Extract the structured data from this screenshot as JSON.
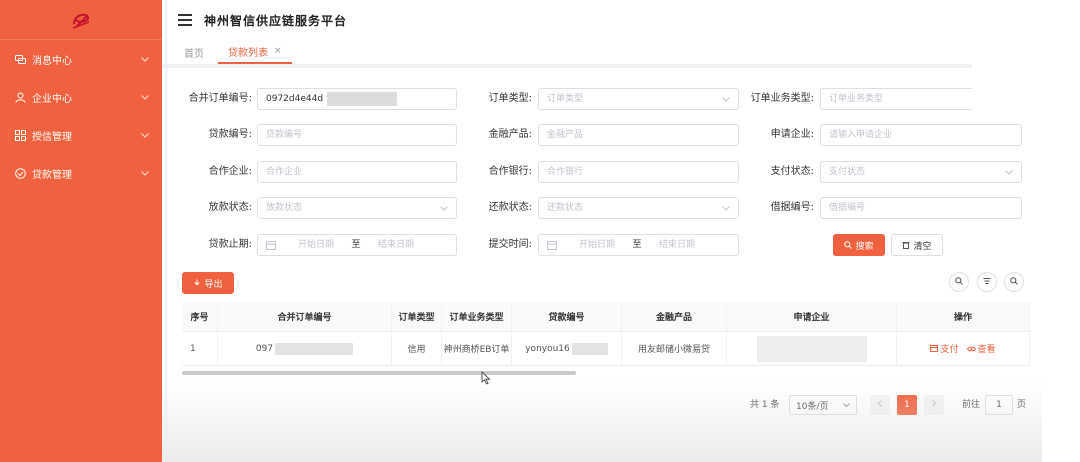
{
  "app": {
    "title": "神州智信供应链服务平台"
  },
  "sidebar": {
    "items": [
      {
        "label": "消息中心",
        "icon": "chat-icon"
      },
      {
        "label": "企业中心",
        "icon": "user-icon"
      },
      {
        "label": "授信管理",
        "icon": "grid-icon"
      },
      {
        "label": "贷款管理",
        "icon": "check-circle-icon"
      }
    ]
  },
  "tabs": {
    "home": "首页",
    "active": "贷款列表",
    "close": "×"
  },
  "filters": {
    "merge_order_no": {
      "label": "合并订单编号:",
      "value": "0972d4e44d"
    },
    "order_type": {
      "label": "订单类型:",
      "placeholder": "订单类型"
    },
    "order_biz_type": {
      "label": "订单业务类型:",
      "placeholder": "订单业务类型"
    },
    "loan_no": {
      "label": "贷款编号:",
      "placeholder": "贷款编号"
    },
    "finance_product": {
      "label": "金融产品:",
      "placeholder": "金融产品"
    },
    "apply_company": {
      "label": "申请企业:",
      "placeholder": "请输入申请企业"
    },
    "partner_company": {
      "label": "合作企业:",
      "placeholder": "合作企业"
    },
    "partner_bank": {
      "label": "合作银行:",
      "placeholder": "合作银行"
    },
    "pay_status": {
      "label": "支付状态:",
      "placeholder": "支付状态"
    },
    "disburse_status": {
      "label": "放款状态:",
      "placeholder": "放款状态"
    },
    "repay_status": {
      "label": "还款状态:",
      "placeholder": "还款状态"
    },
    "receipt_no": {
      "label": "借据编号:",
      "placeholder": "借据编号"
    },
    "loan_expiry": {
      "label": "贷款止期:",
      "start": "开始日期",
      "sep": "至",
      "end": "结束日期"
    },
    "submit_time": {
      "label": "提交时间:",
      "start": "开始日期",
      "sep": "至",
      "end": "结束日期"
    },
    "search_button": "搜索",
    "clear_button": "清空"
  },
  "toolbar": {
    "export_button": "导出"
  },
  "table": {
    "headers": [
      "序号",
      "合并订单编号",
      "订单类型",
      "订单业务类型",
      "贷款编号",
      "金融产品",
      "申请企业",
      "操作"
    ],
    "rows": [
      {
        "index": "1",
        "merge_order_no": "097",
        "order_type": "信用",
        "order_biz_type": "神州商桥EB订单",
        "loan_no": "yonyou16",
        "finance_product": "用友邮储小微易贷",
        "apply_company": "",
        "op_pay": "支付",
        "op_view": "查看"
      }
    ]
  },
  "pagination": {
    "total": "共 1 条",
    "page_size": "10条/页",
    "current_page": "1",
    "goto_label": "前往",
    "goto_value": "1",
    "page_suffix": "页"
  },
  "colors": {
    "brand": "#f0623f"
  }
}
